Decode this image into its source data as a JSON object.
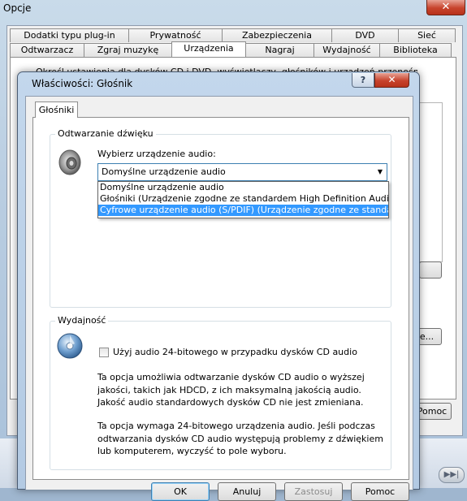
{
  "background_window": {
    "title": "Opcje",
    "close_glyph": "✕",
    "tabs_top": [
      "Dodatki typu plug-in",
      "Prywatność",
      "Zabezpieczenia",
      "DVD",
      "Sieć"
    ],
    "tabs_bottom": [
      "Odtwarzacz",
      "Zgraj muzykę",
      "Urządzenia",
      "Nagraj",
      "Wydajność",
      "Biblioteka"
    ],
    "active_tab": "Urządzenia",
    "visible_text_fragments": [
      "Określ ustawienia dla dysków CD i DVD, wyświetlaczy, głośników i urządzeń przenośnych.",
      "K",
      "e...",
      "Pomoc"
    ],
    "seek_button_glyph": "▶▶|"
  },
  "dialog": {
    "title": "Właściwości: Głośnik",
    "help_glyph": "?",
    "close_glyph": "✕",
    "tab": "Głośniki",
    "playback_group": {
      "legend": "Odtwarzanie dźwięku",
      "icon": "speaker-icon",
      "label": "Wybierz urządzenie audio:",
      "selected_value": "Domyślne urządzenie audio",
      "dropdown_arrow": "▼",
      "options": [
        "Domyślne urządzenie audio",
        "Głośniki (Urządzenie zgodne ze standardem High Definition Audio)",
        "Cyfrowe urządzenie audio (S/PDIF) (Urządzenie zgodne ze standardem High Definition Audio)"
      ],
      "highlighted_option_index": 2
    },
    "performance_group": {
      "legend": "Wydajność",
      "icon": "cd-disc-icon",
      "checkbox_label": "Użyj audio 24-bitowego w przypadku dysków CD audio",
      "checkbox_checked": false,
      "paragraph_1": "Ta opcja umożliwia odtwarzanie dysków CD audio o wyższej jakości, takich jak HDCD, z ich maksymalną jakością audio. Jakość audio standardowych dysków CD nie jest zmieniana.",
      "paragraph_2": "Ta opcja wymaga 24-bitowego urządzenia audio. Jeśli podczas odtwarzania dysków CD audio występują problemy z dźwiękiem lub komputerem, wyczyść to pole wyboru."
    },
    "buttons": [
      "OK",
      "Anuluj",
      "Zastosuj",
      "Pomoc"
    ]
  },
  "colors": {
    "selection_highlight": "#3399ff",
    "close_button_red": "#c7432c",
    "titlebar_glass": "#b9cde1"
  }
}
